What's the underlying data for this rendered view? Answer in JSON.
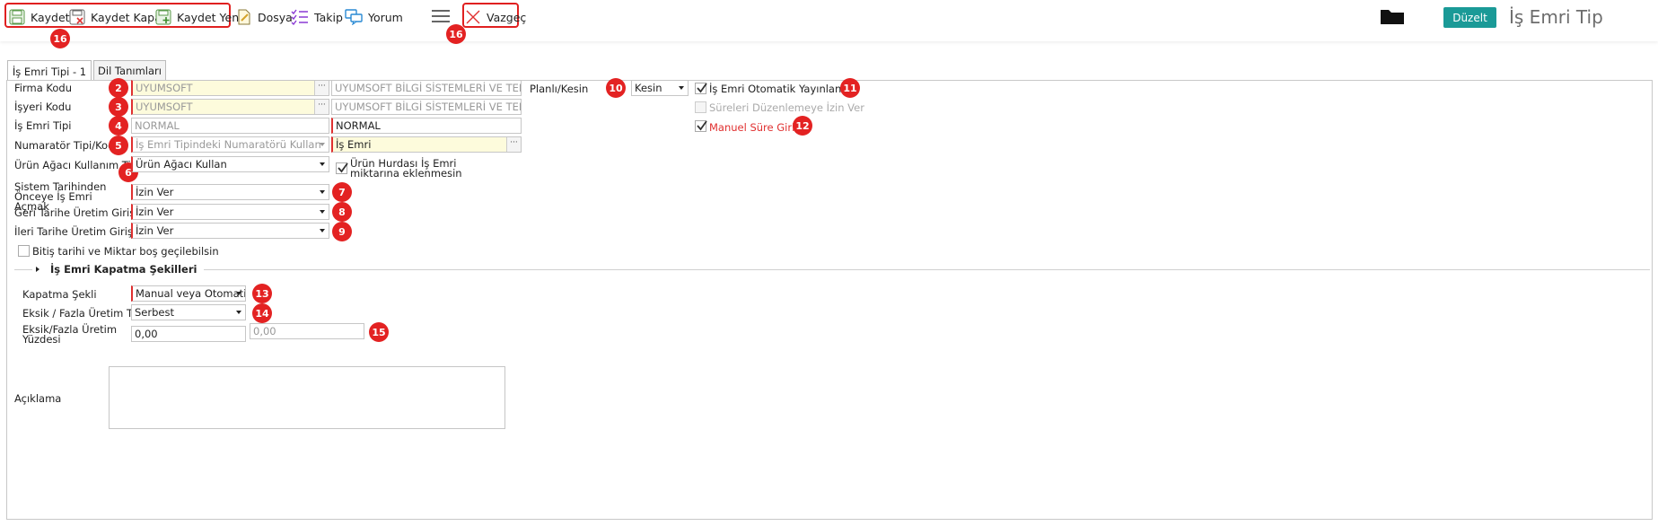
{
  "toolbar": {
    "save_label": "Kaydet",
    "save_close_label": "Kaydet Kapat",
    "save_new_label": "Kaydet Yeni",
    "file_label": "Dosya",
    "follow_label": "Takip",
    "comment_label": "Yorum",
    "cancel_label": "Vazgeç",
    "edit_label": "Düzelt",
    "page_title": "İş Emri Tip"
  },
  "markers": {
    "m16a": "16",
    "m16b": "16",
    "m2": "2",
    "m3": "3",
    "m4": "4",
    "m5": "5",
    "m6": "6",
    "m7": "7",
    "m8": "8",
    "m9": "9",
    "m10": "10",
    "m11": "11",
    "m12": "12",
    "m13": "13",
    "m14": "14",
    "m15": "15"
  },
  "tabs": [
    "İş Emri Tipi - 1",
    "Dil Tanımları"
  ],
  "form": {
    "firm_code_label": "Firma Kodu",
    "firm_code_value": "UYUMSOFT",
    "firm_code_desc": "UYUMSOFT BİLGİ SİSTEMLERİ VE TEKNOLOJİLERİ",
    "branch_code_label": "İşyeri Kodu",
    "branch_code_value": "UYUMSOFT",
    "branch_code_desc": "UYUMSOFT BİLGİ SİSTEMLERİ VE TEKNOLOJİLERİ",
    "wo_type_label": "İş Emri Tipi",
    "wo_type_value": "NORMAL",
    "wo_type_desc": "NORMAL",
    "numerator_label": "Numaratör Tipi/Kodu",
    "numerator_type": "İş Emri Tipindeki Numaratörü Kullan",
    "numerator_code": "İş Emri",
    "bom_usage_label": "Ürün Ağacı Kullanım Tipi",
    "bom_usage_value": "Ürün Ağacı Kullan",
    "scrap_checkbox_label": "Ürün Hurdası İş Emri miktarına eklenmesin",
    "before_system_date_label": "Sistem Tarihinden Önceye İş Emri Açmak",
    "before_system_date_value": "İzin Ver",
    "backdate_label": "Geri Tarihe Üretim Girişi",
    "backdate_value": "İzin Ver",
    "forwarddate_label": "İleri Tarihe Üretim Girişi",
    "forwarddate_value": "İzin Ver",
    "allow_empty_label": "Bitiş tarihi ve Miktar boş geçilebilsin",
    "planned_label": "Planlı/Kesin",
    "planned_value": "Kesin",
    "auto_publish_label": "İş Emri Otomatik Yayınlansın",
    "no_edit_duration_label": "Süreleri Düzenlemeye İzin Ver",
    "manual_duration_label": "Manuel Süre Girişi"
  },
  "closing": {
    "section_title": "İş Emri Kapatma Şekilleri",
    "method_label": "Kapatma Şekli",
    "method_value": "Manual veya Otomatik",
    "tolerance_type_label": "Eksik / Fazla Üretim Tipi",
    "tolerance_type_value": "Serbest",
    "tolerance_pct_label": "Eksik/Fazla Üretim Yüzdesi",
    "tolerance_pct_min": "0,00",
    "tolerance_pct_max": "0,00",
    "description_label": "Açıklama"
  },
  "colors": {
    "accent": "#1a9a97",
    "marker": "#e32222",
    "required": "#e03030",
    "readonly_bg": "#fdfbdc"
  }
}
